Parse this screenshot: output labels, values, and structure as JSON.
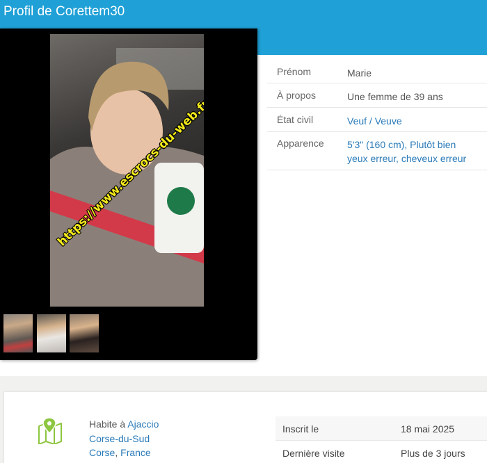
{
  "header": {
    "title": "Profil de Corettem30"
  },
  "photos": {
    "watermark": "https://www.escrocs-du-web.fr",
    "thumbnails": [
      "photo-1",
      "photo-2",
      "photo-3"
    ]
  },
  "profile": [
    {
      "label": "Prénom",
      "value": "Marie"
    },
    {
      "label": "À propos",
      "value": "Une femme de 39 ans"
    },
    {
      "label": "État civil",
      "value": "Veuf / Veuve"
    },
    {
      "label": "Apparence",
      "value_line1": "5'3\" (160 cm), Plutôt bien",
      "value_line2": "yeux erreur, cheveux erreur"
    }
  ],
  "location": {
    "prefix": "Habite à ",
    "city": "Ajaccio",
    "department": "Corse-du-Sud",
    "region": "Corse",
    "separator": ", ",
    "country": "France",
    "icon": "map-pin-icon"
  },
  "activity": [
    {
      "label": "Inscrit le",
      "value": "18 mai 2025"
    },
    {
      "label": "Dernière visite",
      "value": "Plus de 3 jours"
    }
  ],
  "colors": {
    "header": "#1fa0d6",
    "link": "#2a7ab8",
    "icon": "#8dc63f",
    "watermark": "#f4ea1b"
  }
}
